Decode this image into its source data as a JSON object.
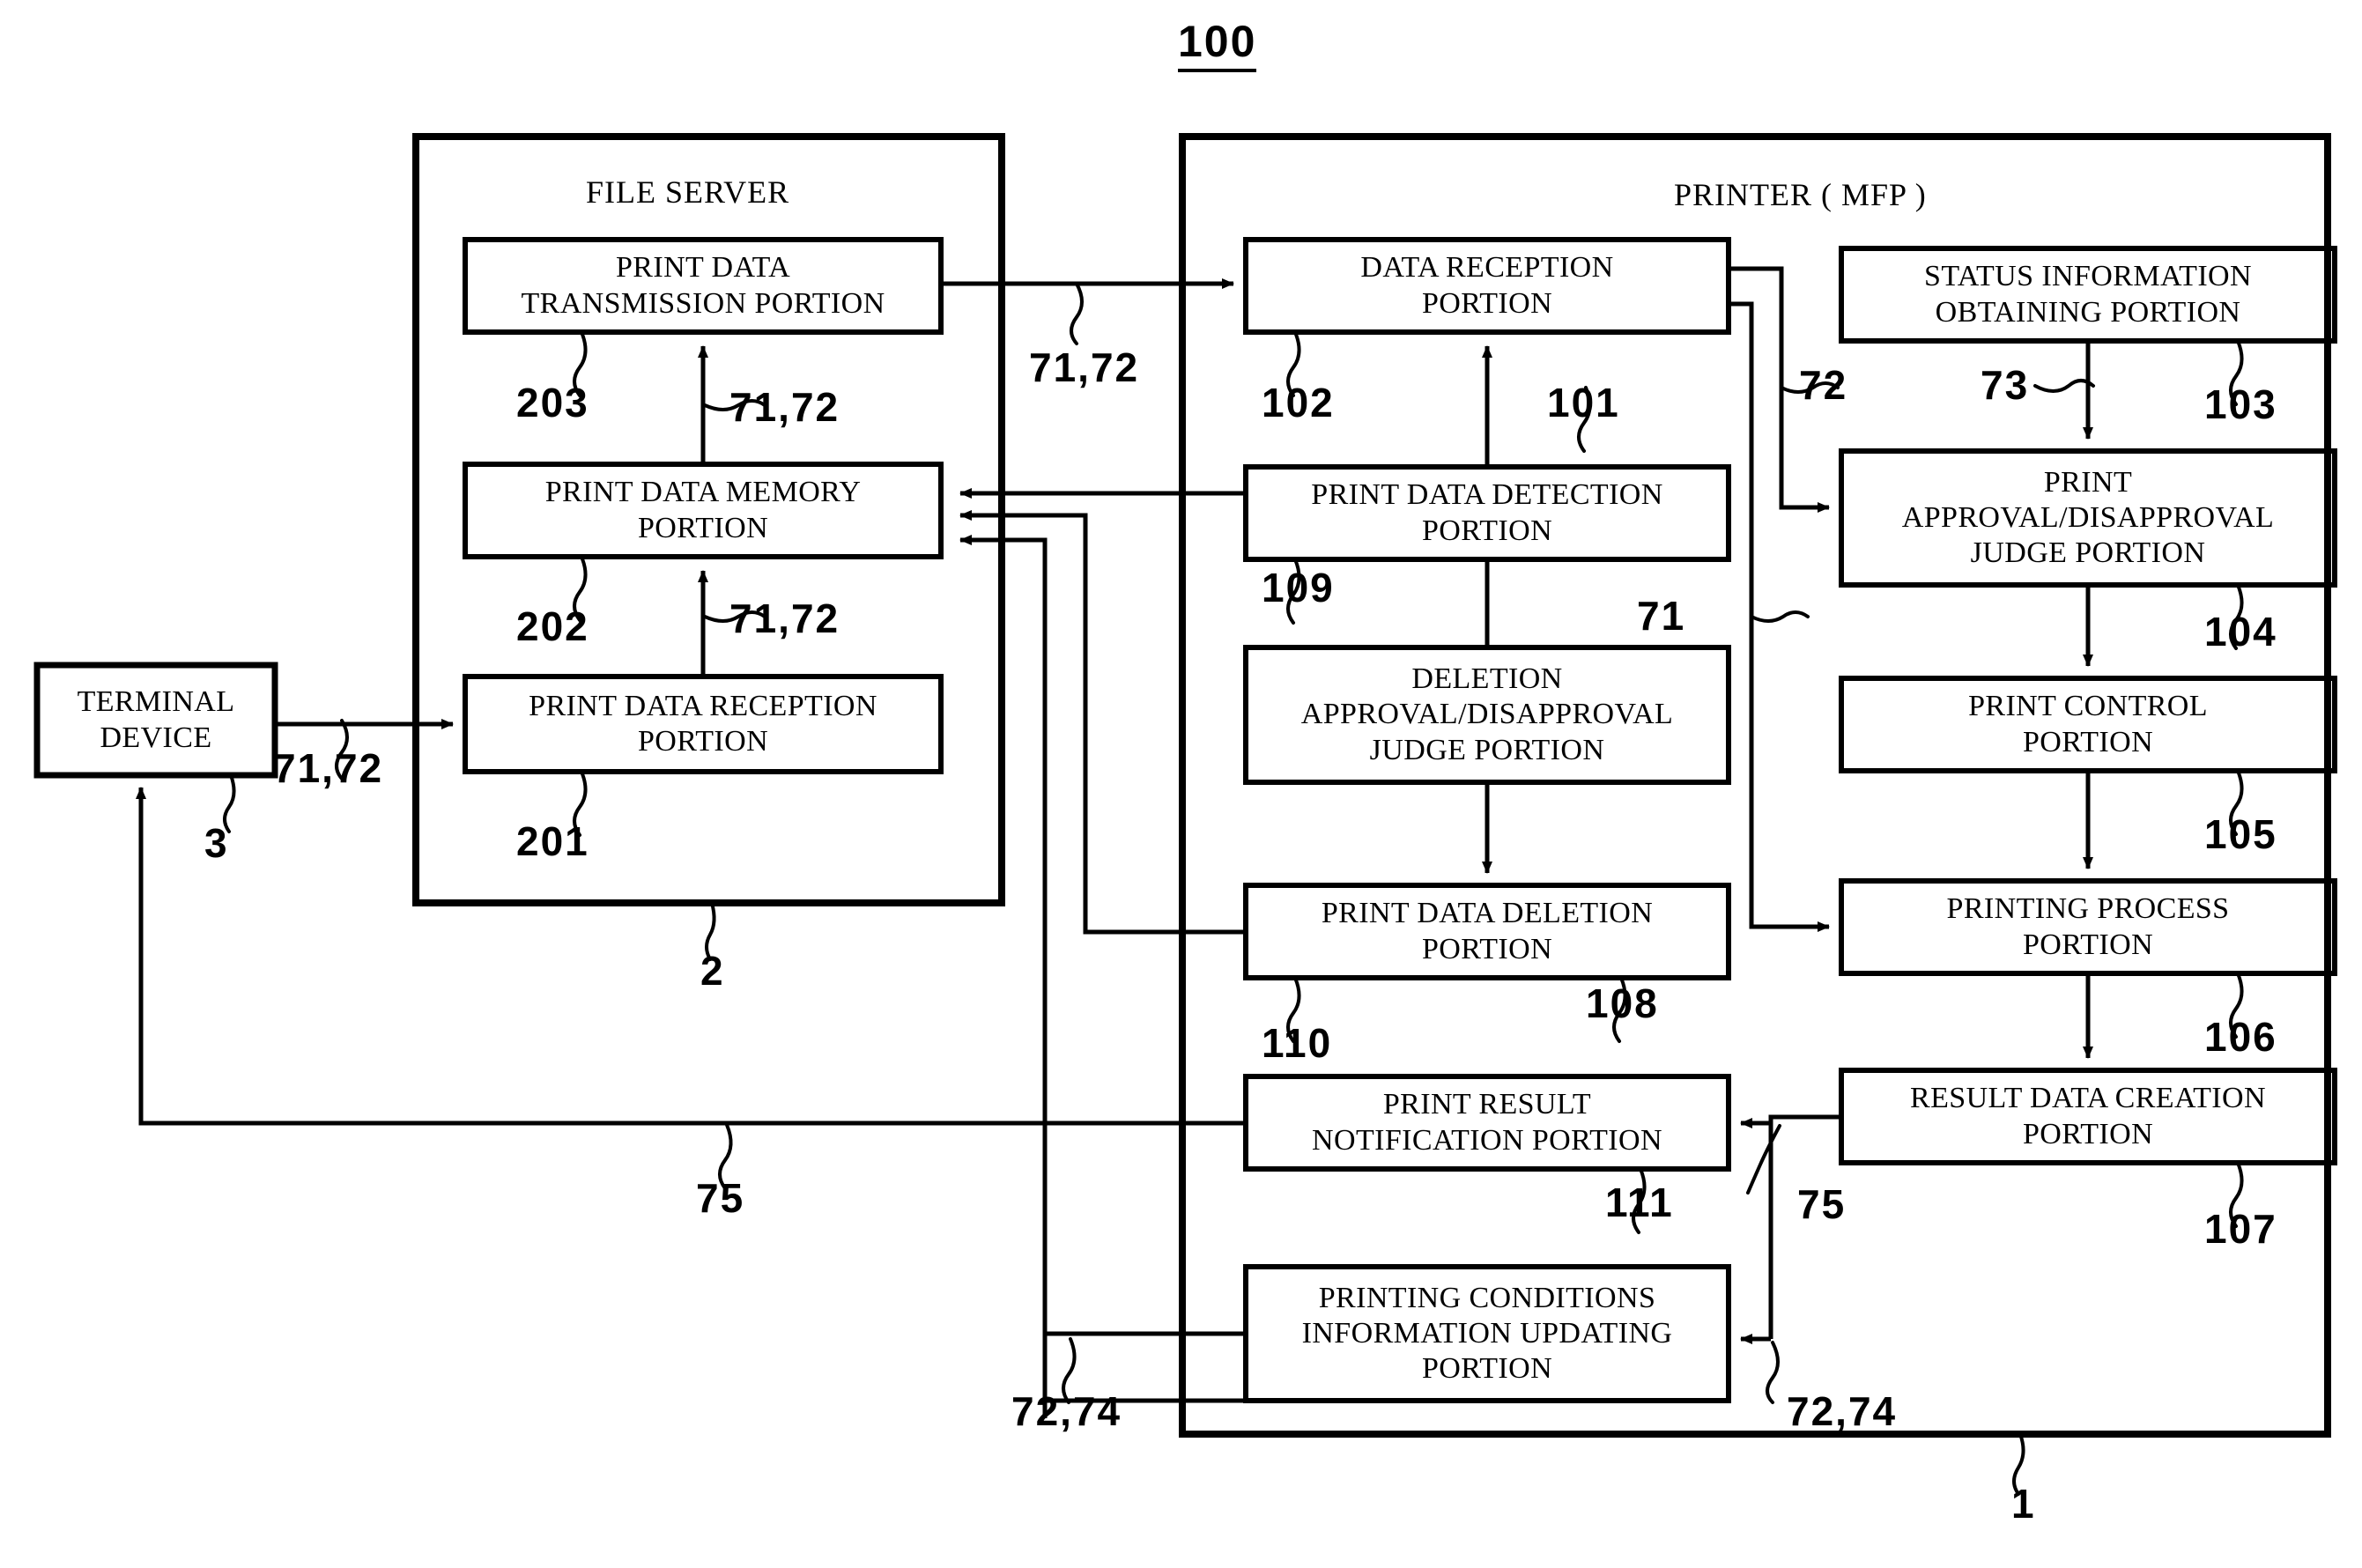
{
  "figure": {
    "number": "100"
  },
  "containers": [
    {
      "id": "file-server",
      "title": "FILE SERVER",
      "ref": "2"
    },
    {
      "id": "printer-mfp",
      "title": "PRINTER ( MFP )",
      "ref": "1"
    }
  ],
  "blocks": [
    {
      "id": "terminal-device",
      "label": "TERMINAL\nDEVICE",
      "ref": "3"
    },
    {
      "id": "print-data-transmission",
      "label": "PRINT DATA\nTRANSMISSION PORTION",
      "ref": "203"
    },
    {
      "id": "print-data-memory",
      "label": "PRINT DATA MEMORY\nPORTION",
      "ref": "202"
    },
    {
      "id": "print-data-reception",
      "label": "PRINT DATA RECEPTION\nPORTION",
      "ref": "201"
    },
    {
      "id": "data-reception",
      "label": "DATA RECEPTION\nPORTION",
      "ref": "102"
    },
    {
      "id": "print-data-detection",
      "label": "PRINT DATA DETECTION\nPORTION",
      "ref": "109"
    },
    {
      "id": "deletion-judge",
      "label": "DELETION\nAPPROVAL/DISAPPROVAL\nJUDGE PORTION",
      "ref": "110"
    },
    {
      "id": "print-data-deletion",
      "label": "PRINT DATA DELETION\nPORTION",
      "ref": "108"
    },
    {
      "id": "print-result-notify",
      "label": "PRINT RESULT\nNOTIFICATION PORTION",
      "ref": "111"
    },
    {
      "id": "printing-conditions",
      "label": "PRINTING CONDITIONS\nINFORMATION UPDATING\nPORTION",
      "ref": ""
    },
    {
      "id": "status-info-obtaining",
      "label": "STATUS INFORMATION\nOBTAINING PORTION",
      "ref": "103"
    },
    {
      "id": "print-judge",
      "label": "PRINT\nAPPROVAL/DISAPPROVAL\nJUDGE PORTION",
      "ref": "104"
    },
    {
      "id": "print-control",
      "label": "PRINT CONTROL\nPORTION",
      "ref": "105"
    },
    {
      "id": "printing-process",
      "label": "PRINTING PROCESS\nPORTION",
      "ref": "106"
    },
    {
      "id": "result-data-creation",
      "label": "RESULT DATA CREATION\nPORTION",
      "ref": "107"
    }
  ],
  "signal_labels": {
    "terminal_to_server": "71,72",
    "reception_to_memory": "71,72",
    "memory_to_transmission": "71,72",
    "server_to_printer": "71,72",
    "printer_right_72": "72",
    "status_73": "73",
    "detect_71": "71",
    "result_75": "75",
    "bottom_left_75": "75",
    "bottom_72_74": "72,74",
    "right_72_74": "72,74",
    "ref_101": "101"
  }
}
